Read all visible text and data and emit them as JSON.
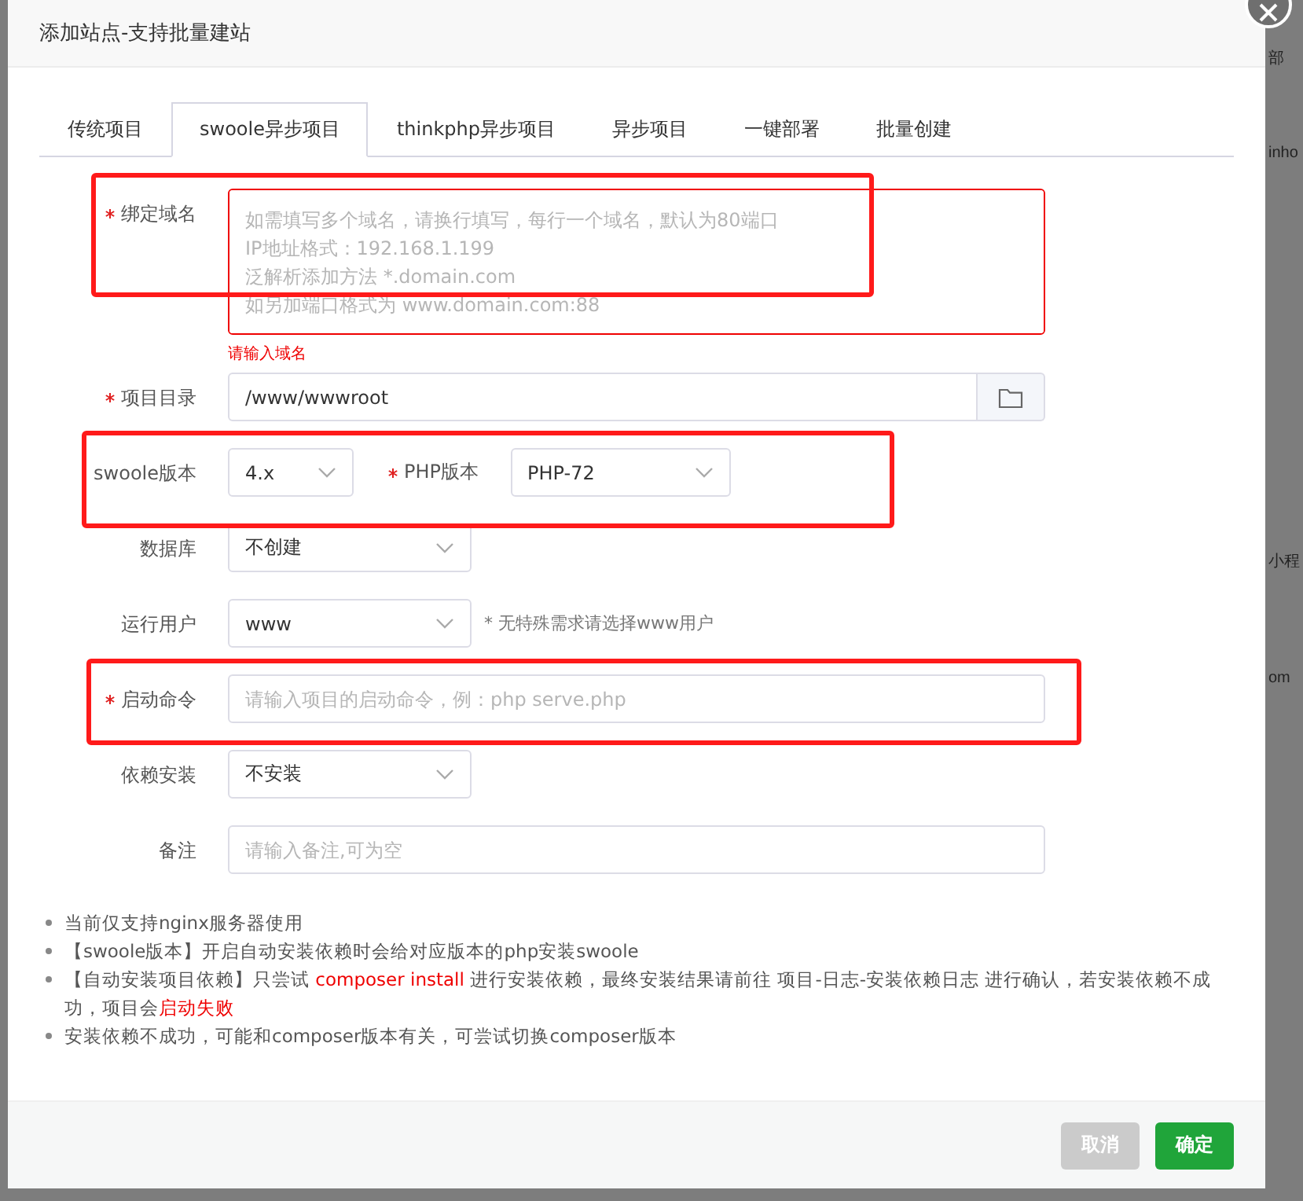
{
  "backdrop_fragments": [
    "部",
    "inho",
    "小程",
    "om"
  ],
  "dialog": {
    "title": "添加站点-支持批量建站",
    "tabs": [
      {
        "label": "传统项目",
        "selected": false
      },
      {
        "label": "swoole异步项目",
        "selected": true
      },
      {
        "label": "thinkphp异步项目",
        "selected": false
      },
      {
        "label": "异步项目",
        "selected": false
      },
      {
        "label": "一键部署",
        "selected": false
      },
      {
        "label": "批量创建",
        "selected": false
      }
    ],
    "form": [
      {
        "kind": "textarea",
        "label": "绑定域名",
        "required": true,
        "highlighted": true,
        "invalid": true,
        "placeholder": "如需填写多个域名，请换行填写，每行一个域名，默认为80端口\nIP地址格式：192.168.1.199\n泛解析添加方法 *.domain.com\n如另加端口格式为 www.domain.com:88",
        "error": "请输入域名"
      },
      {
        "kind": "path",
        "label": "项目目录",
        "required": true,
        "highlighted": false,
        "value": "/www/wwwroot"
      },
      {
        "kind": "select_pair",
        "label": "swoole版本",
        "required": false,
        "highlighted": true,
        "value": "4.x",
        "second": {
          "label": "PHP版本",
          "required": true,
          "value": "PHP-72"
        }
      },
      {
        "kind": "select",
        "label": "数据库",
        "required": false,
        "highlighted": false,
        "value": "不创建"
      },
      {
        "kind": "select",
        "label": "运行用户",
        "required": false,
        "highlighted": false,
        "value": "www",
        "hint": "* 无特殊需求请选择www用户"
      },
      {
        "kind": "input",
        "label": "启动命令",
        "required": true,
        "highlighted": true,
        "placeholder": "请输入项目的启动命令，例：php serve.php"
      },
      {
        "kind": "select",
        "label": "依赖安装",
        "required": false,
        "highlighted": false,
        "value": "不安装"
      },
      {
        "kind": "input",
        "label": "备注",
        "required": false,
        "highlighted": false,
        "placeholder": "请输入备注,可为空"
      }
    ],
    "notes": [
      {
        "segments": [
          {
            "text": "当前仅支持nginx服务器使用",
            "highlight": false
          }
        ]
      },
      {
        "segments": [
          {
            "text": "【swoole版本】开启自动安装依赖时会给对应版本的php安装swoole",
            "highlight": false
          }
        ]
      },
      {
        "segments": [
          {
            "text": "【自动安装项目依赖】只尝试 ",
            "highlight": false
          },
          {
            "text": "composer install",
            "highlight": true
          },
          {
            "text": " 进行安装依赖，最终安装结果请前往 项目-日志-安装依赖日志 进行确认，若安装依赖不成功，项目会",
            "highlight": false
          },
          {
            "text": "启动失败",
            "highlight": true
          }
        ]
      },
      {
        "segments": [
          {
            "text": "安装依赖不成功，可能和composer版本有关，可尝试切换composer版本",
            "highlight": false
          }
        ]
      }
    ],
    "buttons": [
      {
        "label": "取消",
        "kind": "cancel"
      },
      {
        "label": "确定",
        "kind": "confirm"
      }
    ]
  }
}
